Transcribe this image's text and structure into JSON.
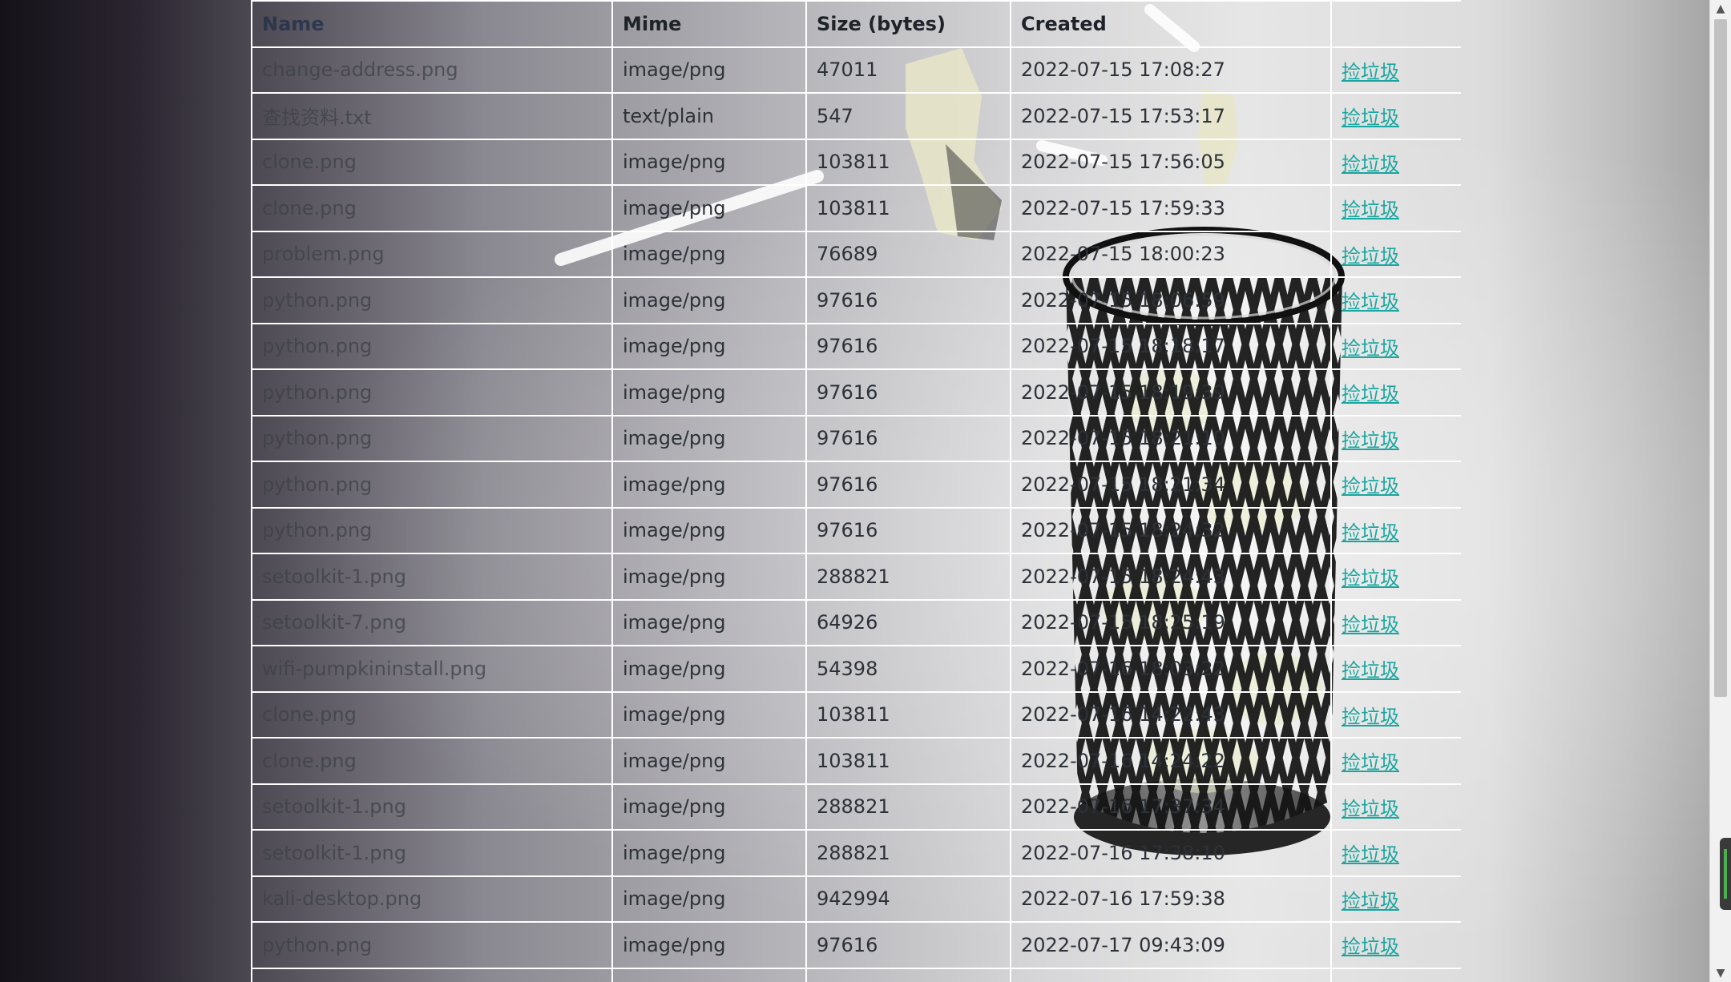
{
  "table": {
    "headers": [
      "Name",
      "Mime",
      "Size (bytes)",
      "Created",
      ""
    ],
    "action_label": "捡垃圾",
    "rows": [
      {
        "name": "change-address.png",
        "mime": "image/png",
        "size": "47011",
        "created": "2022-07-15 17:08:27"
      },
      {
        "name": "查找资料.txt",
        "mime": "text/plain",
        "size": "547",
        "created": "2022-07-15 17:53:17"
      },
      {
        "name": "clone.png",
        "mime": "image/png",
        "size": "103811",
        "created": "2022-07-15 17:56:05"
      },
      {
        "name": "clone.png",
        "mime": "image/png",
        "size": "103811",
        "created": "2022-07-15 17:59:33"
      },
      {
        "name": "problem.png",
        "mime": "image/png",
        "size": "76689",
        "created": "2022-07-15 18:00:23"
      },
      {
        "name": "python.png",
        "mime": "image/png",
        "size": "97616",
        "created": "2022-07-15 18:06:59"
      },
      {
        "name": "python.png",
        "mime": "image/png",
        "size": "97616",
        "created": "2022-07-15 18:18:17"
      },
      {
        "name": "python.png",
        "mime": "image/png",
        "size": "97616",
        "created": "2022-07-15 18:19:39"
      },
      {
        "name": "python.png",
        "mime": "image/png",
        "size": "97616",
        "created": "2022-07-15 18:21:10"
      },
      {
        "name": "python.png",
        "mime": "image/png",
        "size": "97616",
        "created": "2022-07-15 18:21:34"
      },
      {
        "name": "python.png",
        "mime": "image/png",
        "size": "97616",
        "created": "2022-07-15 18:24:32"
      },
      {
        "name": "setoolkit-1.png",
        "mime": "image/png",
        "size": "288821",
        "created": "2022-07-15 18:24:43"
      },
      {
        "name": "setoolkit-7.png",
        "mime": "image/png",
        "size": "64926",
        "created": "2022-07-15 18:25:19"
      },
      {
        "name": "wifi-pumpkininstall.png",
        "mime": "image/png",
        "size": "54398",
        "created": "2022-07-16 18:03:22"
      },
      {
        "name": "clone.png",
        "mime": "image/png",
        "size": "103811",
        "created": "2022-07-16 14:22:43"
      },
      {
        "name": "clone.png",
        "mime": "image/png",
        "size": "103811",
        "created": "2022-07-16 14:24:22"
      },
      {
        "name": "setoolkit-1.png",
        "mime": "image/png",
        "size": "288821",
        "created": "2022-07-16 17:37:34"
      },
      {
        "name": "setoolkit-1.png",
        "mime": "image/png",
        "size": "288821",
        "created": "2022-07-16 17:38:10"
      },
      {
        "name": "kali-desktop.png",
        "mime": "image/png",
        "size": "942994",
        "created": "2022-07-16 17:59:38"
      },
      {
        "name": "python.png",
        "mime": "image/png",
        "size": "97616",
        "created": "2022-07-17 09:43:09"
      },
      {
        "name": "",
        "mime": "",
        "size": "",
        "created": ""
      }
    ]
  },
  "colors": {
    "link": "#1aa6a0",
    "grid": "#ffffff"
  },
  "icons": {
    "background": "trash-can-illustration",
    "scroll_up": "chevron-up-icon",
    "scroll_down": "chevron-down-icon"
  }
}
